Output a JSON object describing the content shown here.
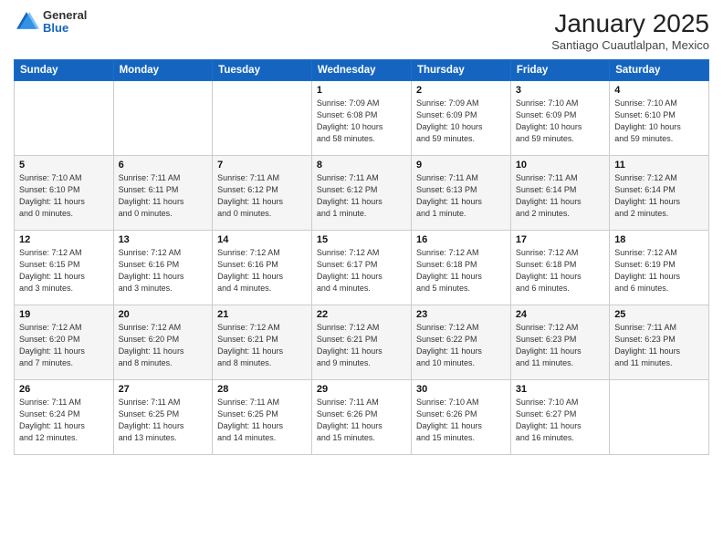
{
  "header": {
    "logo": {
      "general": "General",
      "blue": "Blue"
    },
    "title": "January 2025",
    "subtitle": "Santiago Cuautlalpan, Mexico"
  },
  "days_of_week": [
    "Sunday",
    "Monday",
    "Tuesday",
    "Wednesday",
    "Thursday",
    "Friday",
    "Saturday"
  ],
  "weeks": [
    [
      {
        "day": "",
        "info": ""
      },
      {
        "day": "",
        "info": ""
      },
      {
        "day": "",
        "info": ""
      },
      {
        "day": "1",
        "info": "Sunrise: 7:09 AM\nSunset: 6:08 PM\nDaylight: 10 hours\nand 58 minutes."
      },
      {
        "day": "2",
        "info": "Sunrise: 7:09 AM\nSunset: 6:09 PM\nDaylight: 10 hours\nand 59 minutes."
      },
      {
        "day": "3",
        "info": "Sunrise: 7:10 AM\nSunset: 6:09 PM\nDaylight: 10 hours\nand 59 minutes."
      },
      {
        "day": "4",
        "info": "Sunrise: 7:10 AM\nSunset: 6:10 PM\nDaylight: 10 hours\nand 59 minutes."
      }
    ],
    [
      {
        "day": "5",
        "info": "Sunrise: 7:10 AM\nSunset: 6:10 PM\nDaylight: 11 hours\nand 0 minutes."
      },
      {
        "day": "6",
        "info": "Sunrise: 7:11 AM\nSunset: 6:11 PM\nDaylight: 11 hours\nand 0 minutes."
      },
      {
        "day": "7",
        "info": "Sunrise: 7:11 AM\nSunset: 6:12 PM\nDaylight: 11 hours\nand 0 minutes."
      },
      {
        "day": "8",
        "info": "Sunrise: 7:11 AM\nSunset: 6:12 PM\nDaylight: 11 hours\nand 1 minute."
      },
      {
        "day": "9",
        "info": "Sunrise: 7:11 AM\nSunset: 6:13 PM\nDaylight: 11 hours\nand 1 minute."
      },
      {
        "day": "10",
        "info": "Sunrise: 7:11 AM\nSunset: 6:14 PM\nDaylight: 11 hours\nand 2 minutes."
      },
      {
        "day": "11",
        "info": "Sunrise: 7:12 AM\nSunset: 6:14 PM\nDaylight: 11 hours\nand 2 minutes."
      }
    ],
    [
      {
        "day": "12",
        "info": "Sunrise: 7:12 AM\nSunset: 6:15 PM\nDaylight: 11 hours\nand 3 minutes."
      },
      {
        "day": "13",
        "info": "Sunrise: 7:12 AM\nSunset: 6:16 PM\nDaylight: 11 hours\nand 3 minutes."
      },
      {
        "day": "14",
        "info": "Sunrise: 7:12 AM\nSunset: 6:16 PM\nDaylight: 11 hours\nand 4 minutes."
      },
      {
        "day": "15",
        "info": "Sunrise: 7:12 AM\nSunset: 6:17 PM\nDaylight: 11 hours\nand 4 minutes."
      },
      {
        "day": "16",
        "info": "Sunrise: 7:12 AM\nSunset: 6:18 PM\nDaylight: 11 hours\nand 5 minutes."
      },
      {
        "day": "17",
        "info": "Sunrise: 7:12 AM\nSunset: 6:18 PM\nDaylight: 11 hours\nand 6 minutes."
      },
      {
        "day": "18",
        "info": "Sunrise: 7:12 AM\nSunset: 6:19 PM\nDaylight: 11 hours\nand 6 minutes."
      }
    ],
    [
      {
        "day": "19",
        "info": "Sunrise: 7:12 AM\nSunset: 6:20 PM\nDaylight: 11 hours\nand 7 minutes."
      },
      {
        "day": "20",
        "info": "Sunrise: 7:12 AM\nSunset: 6:20 PM\nDaylight: 11 hours\nand 8 minutes."
      },
      {
        "day": "21",
        "info": "Sunrise: 7:12 AM\nSunset: 6:21 PM\nDaylight: 11 hours\nand 8 minutes."
      },
      {
        "day": "22",
        "info": "Sunrise: 7:12 AM\nSunset: 6:21 PM\nDaylight: 11 hours\nand 9 minutes."
      },
      {
        "day": "23",
        "info": "Sunrise: 7:12 AM\nSunset: 6:22 PM\nDaylight: 11 hours\nand 10 minutes."
      },
      {
        "day": "24",
        "info": "Sunrise: 7:12 AM\nSunset: 6:23 PM\nDaylight: 11 hours\nand 11 minutes."
      },
      {
        "day": "25",
        "info": "Sunrise: 7:11 AM\nSunset: 6:23 PM\nDaylight: 11 hours\nand 11 minutes."
      }
    ],
    [
      {
        "day": "26",
        "info": "Sunrise: 7:11 AM\nSunset: 6:24 PM\nDaylight: 11 hours\nand 12 minutes."
      },
      {
        "day": "27",
        "info": "Sunrise: 7:11 AM\nSunset: 6:25 PM\nDaylight: 11 hours\nand 13 minutes."
      },
      {
        "day": "28",
        "info": "Sunrise: 7:11 AM\nSunset: 6:25 PM\nDaylight: 11 hours\nand 14 minutes."
      },
      {
        "day": "29",
        "info": "Sunrise: 7:11 AM\nSunset: 6:26 PM\nDaylight: 11 hours\nand 15 minutes."
      },
      {
        "day": "30",
        "info": "Sunrise: 7:10 AM\nSunset: 6:26 PM\nDaylight: 11 hours\nand 15 minutes."
      },
      {
        "day": "31",
        "info": "Sunrise: 7:10 AM\nSunset: 6:27 PM\nDaylight: 11 hours\nand 16 minutes."
      },
      {
        "day": "",
        "info": ""
      }
    ]
  ]
}
